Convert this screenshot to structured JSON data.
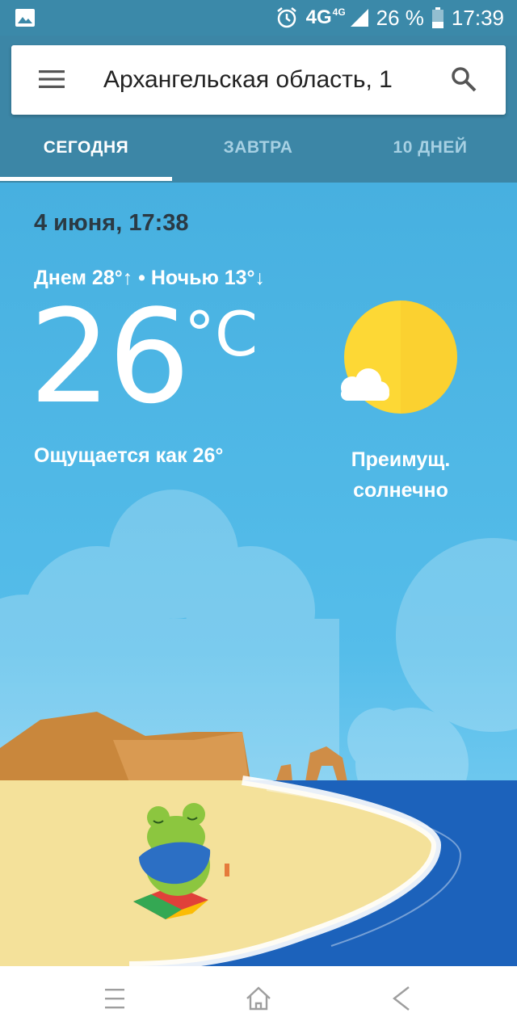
{
  "status_bar": {
    "network": "4G",
    "network_sup": "4G",
    "battery": "26 %",
    "time": "17:39",
    "icons": [
      "gallery-icon",
      "alarm-icon",
      "signal-icon",
      "battery-icon"
    ]
  },
  "search": {
    "location": "Архангельская область, 1"
  },
  "tabs": [
    {
      "label": "СЕГОДНЯ",
      "active": true
    },
    {
      "label": "ЗАВТРА",
      "active": false
    },
    {
      "label": "10 ДНЕЙ",
      "active": false
    }
  ],
  "weather": {
    "date_time": "4 июня, 17:38",
    "day_night": "Днем 28°↑ • Ночью 13°↓",
    "temperature": "26",
    "unit": "°C",
    "feels_like": "Ощущается как 26°",
    "condition_line1": "Преимущ.",
    "condition_line2": "солнечно"
  },
  "nav_bar": {
    "buttons": [
      "menu-icon",
      "home-icon",
      "back-icon"
    ]
  },
  "colors": {
    "header": "#3c86a6",
    "sky": "#49b3e2",
    "sun": "#fdd835",
    "sea": "#1e67c0",
    "sand": "#f5e29a"
  }
}
